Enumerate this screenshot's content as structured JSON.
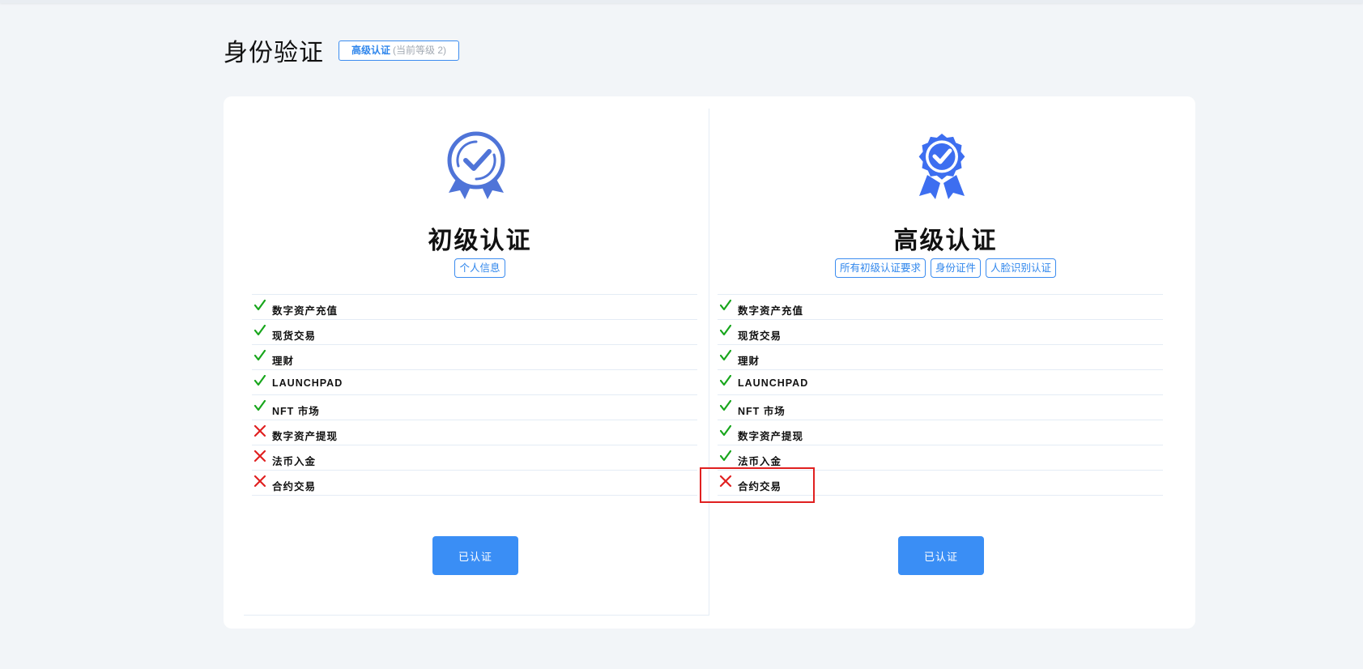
{
  "page": {
    "title": "身份验证",
    "level_badge": {
      "level": "高级认证",
      "current": "(当前等级 2)"
    }
  },
  "colors": {
    "accent": "#3a8ef5",
    "check": "#18a61c",
    "cross": "#e02020",
    "medal": "#4f74d8"
  },
  "columns": [
    {
      "title": "初级认证",
      "icon": "award-ribbon-icon",
      "requirements": [
        "个人信息"
      ],
      "features": [
        {
          "label": "数字资产充值",
          "status": "check"
        },
        {
          "label": "现货交易",
          "status": "check"
        },
        {
          "label": "理财",
          "status": "check"
        },
        {
          "label": "LAUNCHPAD",
          "status": "check"
        },
        {
          "label": "NFT 市场",
          "status": "check"
        },
        {
          "label": "数字资产提现",
          "status": "cross"
        },
        {
          "label": "法币入金",
          "status": "cross"
        },
        {
          "label": "合约交易",
          "status": "cross"
        }
      ],
      "button_label": "已认证"
    },
    {
      "title": "高级认证",
      "icon": "award-badge-icon",
      "requirements": [
        "所有初级认证要求",
        "身份证件",
        "人脸识别认证"
      ],
      "features": [
        {
          "label": "数字资产充值",
          "status": "check"
        },
        {
          "label": "现货交易",
          "status": "check"
        },
        {
          "label": "理财",
          "status": "check"
        },
        {
          "label": "LAUNCHPAD",
          "status": "check"
        },
        {
          "label": "NFT 市场",
          "status": "check"
        },
        {
          "label": "数字资产提现",
          "status": "check"
        },
        {
          "label": "法币入金",
          "status": "check"
        },
        {
          "label": "合约交易",
          "status": "cross"
        }
      ],
      "button_label": "已认证"
    }
  ]
}
